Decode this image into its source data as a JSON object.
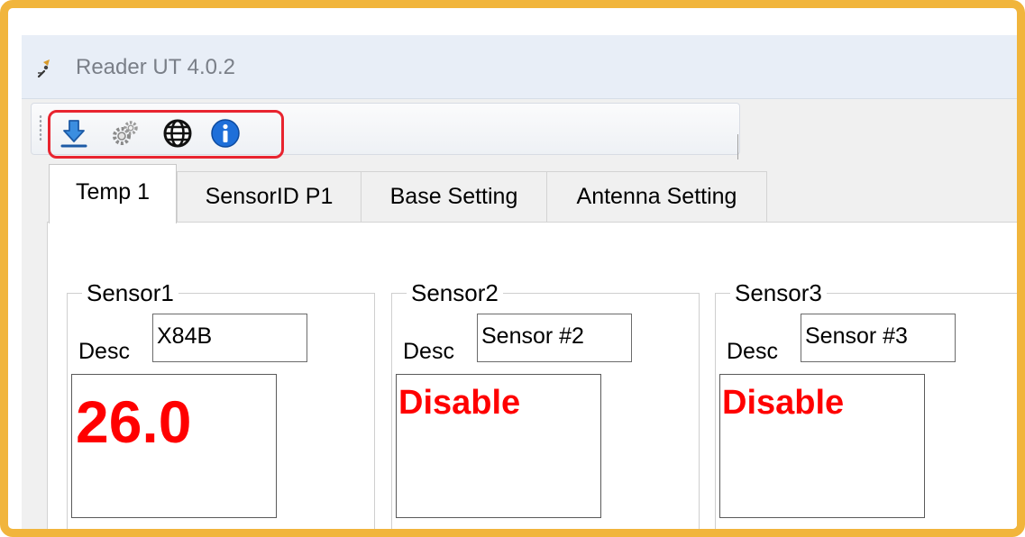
{
  "window": {
    "title": "Reader UT 4.0.2"
  },
  "toolbar": {
    "buttons": [
      {
        "icon": "download-icon"
      },
      {
        "icon": "gears-icon"
      },
      {
        "icon": "globe-icon"
      },
      {
        "icon": "info-icon"
      }
    ],
    "highlight_color": "#e8242f"
  },
  "tabs": [
    {
      "label": "Temp 1",
      "active": true
    },
    {
      "label": "SensorID P1",
      "active": false
    },
    {
      "label": "Base Setting",
      "active": false
    },
    {
      "label": "Antenna Setting",
      "active": false
    }
  ],
  "sensors": [
    {
      "name": "Sensor1",
      "desc_label": "Desc",
      "desc_value": "X84B",
      "reading": "26.0"
    },
    {
      "name": "Sensor2",
      "desc_label": "Desc",
      "desc_value": "Sensor #2",
      "reading": "Disable"
    },
    {
      "name": "Sensor3",
      "desc_label": "Desc",
      "desc_value": "Sensor #3",
      "reading": "Disable"
    }
  ],
  "colors": {
    "frame": "#f1b53c",
    "reading": "#ff0000"
  }
}
